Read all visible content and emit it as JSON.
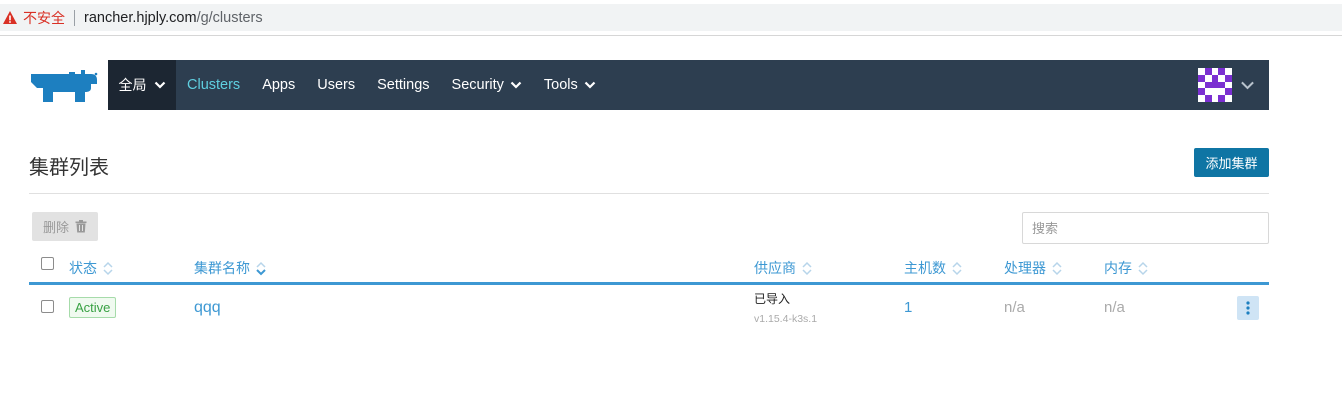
{
  "browser": {
    "insecure_label": "不安全",
    "url_host": "rancher.hjply.com",
    "url_path": "/g/clusters"
  },
  "nav": {
    "global_label": "全局",
    "items": [
      {
        "label": "Clusters",
        "active": true
      },
      {
        "label": "Apps"
      },
      {
        "label": "Users"
      },
      {
        "label": "Settings"
      },
      {
        "label": "Security",
        "dropdown": true
      },
      {
        "label": "Tools",
        "dropdown": true
      }
    ]
  },
  "page": {
    "title": "集群列表",
    "add_button": "添加集群",
    "delete_button": "删除",
    "search_placeholder": "搜索"
  },
  "table": {
    "columns": {
      "state": "状态",
      "name": "集群名称",
      "provider": "供应商",
      "nodes": "主机数",
      "cpu": "处理器",
      "memory": "内存"
    },
    "rows": [
      {
        "state": "Active",
        "name": "qqq",
        "provider": "已导入",
        "version": "v1.15.4-k3s.1",
        "nodes": "1",
        "cpu": "n/a",
        "memory": "n/a"
      }
    ]
  },
  "colors": {
    "navbar": "#2d3e50",
    "accent": "#3d98d3",
    "primary_button": "#0f75a4",
    "active_nav": "#5fcfe0",
    "active_badge": "#38a143"
  }
}
